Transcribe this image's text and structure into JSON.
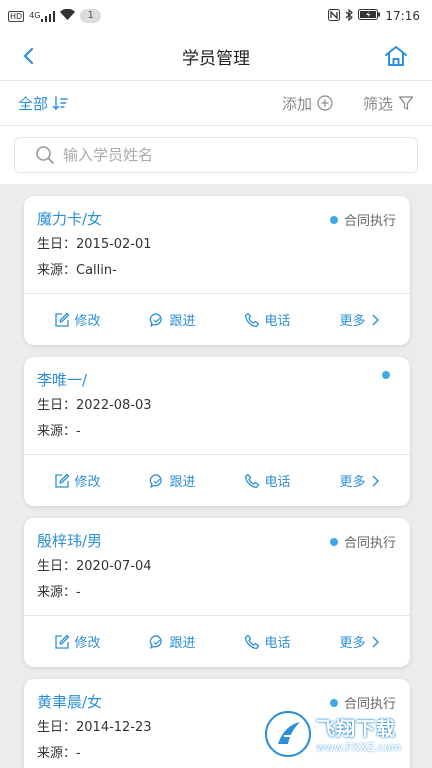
{
  "status_bar": {
    "left_tag": "HD",
    "signal_label": "4G",
    "notification_count": "1",
    "time": "17:16"
  },
  "header": {
    "title": "学员管理"
  },
  "toolbar": {
    "filter_label": "全部",
    "add_label": "添加",
    "screen_label": "筛选"
  },
  "search": {
    "placeholder": "输入学员姓名",
    "value": ""
  },
  "students": [
    {
      "name": "魔力卡/女",
      "status": "合同执行",
      "birthday_label": "生日：",
      "birthday": "2015-02-01",
      "source_label": "来源：",
      "source": "Callin-"
    },
    {
      "name": "李唯一/",
      "status": "",
      "birthday_label": "生日：",
      "birthday": "2022-08-03",
      "source_label": "来源：",
      "source": "-"
    },
    {
      "name": "殷梓玮/男",
      "status": "合同执行",
      "birthday_label": "生日：",
      "birthday": "2020-07-04",
      "source_label": "来源：",
      "source": "-"
    },
    {
      "name": "黄聿晨/女",
      "status": "合同执行",
      "birthday_label": "生日：",
      "birthday": "2014-12-23",
      "source_label": "来源：",
      "source": "-"
    }
  ],
  "actions": {
    "edit": "修改",
    "follow": "跟进",
    "phone": "电话",
    "more": "更多"
  },
  "watermark": {
    "main": "飞翔下载",
    "url": "www.FXXZ.com"
  },
  "colors": {
    "accent": "#2c8fd8",
    "status_dot": "#3fa8e8",
    "background": "#ececec"
  }
}
